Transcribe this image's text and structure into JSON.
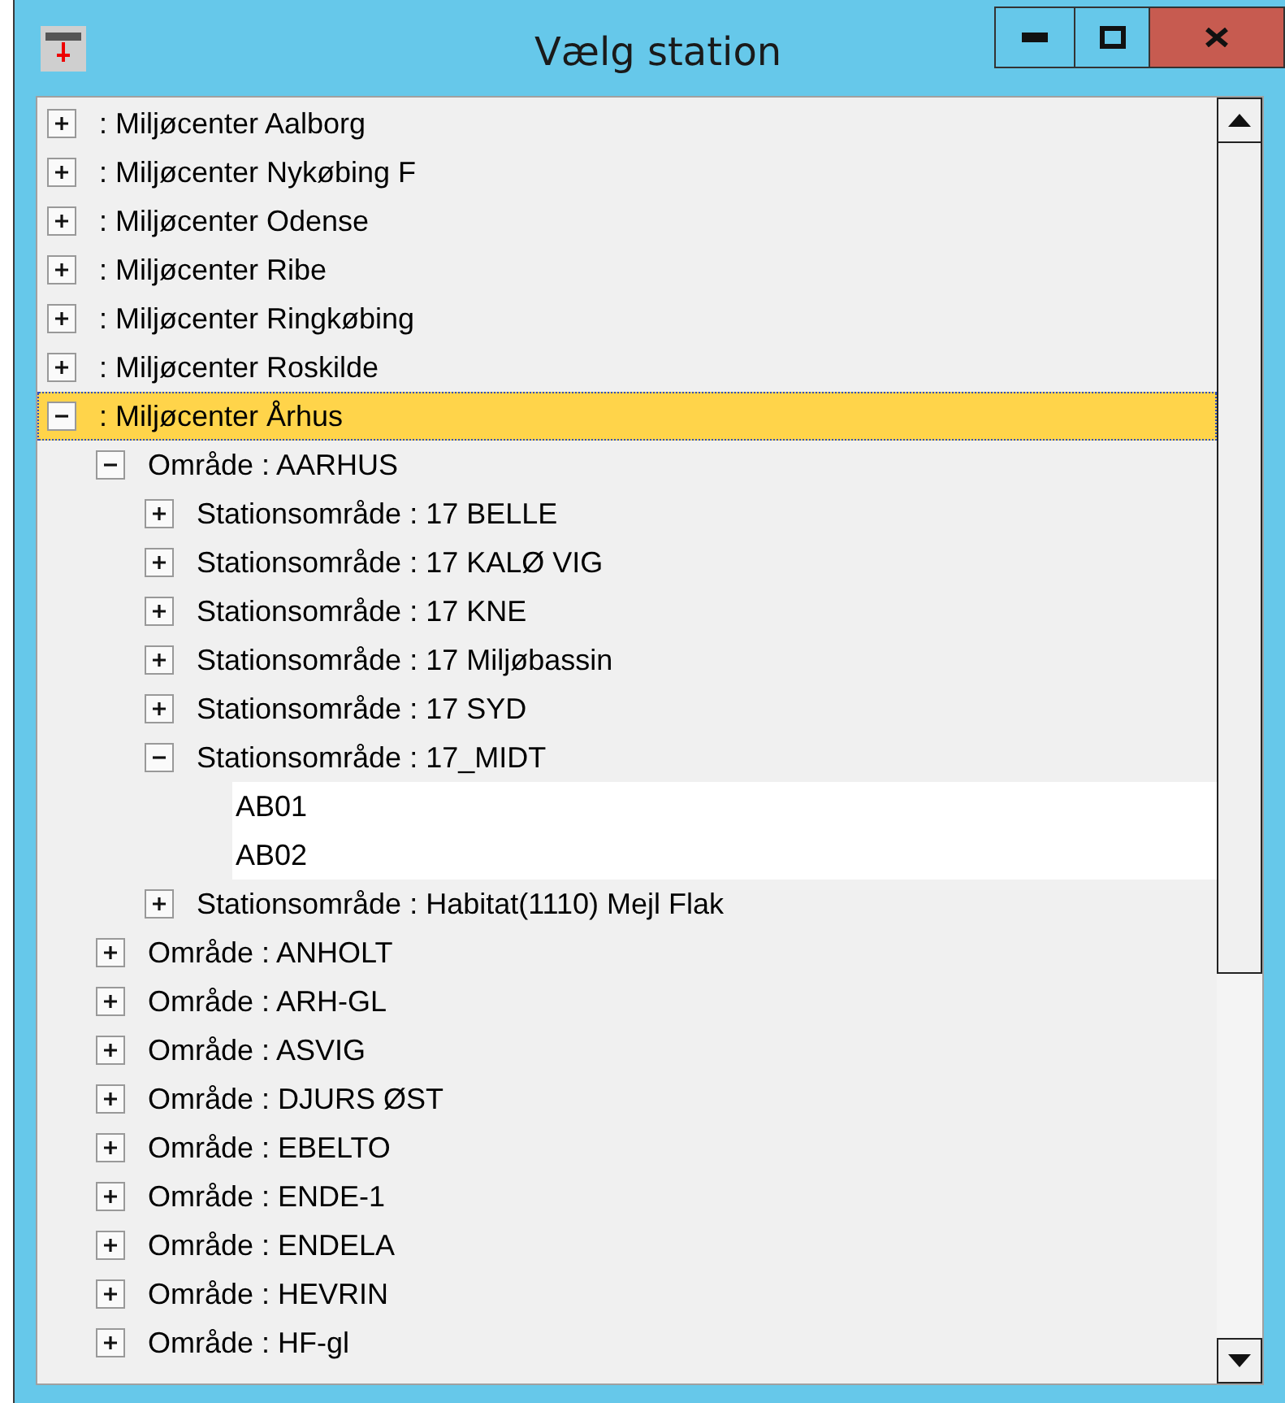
{
  "window": {
    "title": "Vælg station"
  },
  "tree": [
    {
      "kind": "group",
      "label": ": Miljøcenter Aalborg",
      "expanded": false,
      "selected": false
    },
    {
      "kind": "group",
      "label": ": Miljøcenter Nykøbing F",
      "expanded": false,
      "selected": false
    },
    {
      "kind": "group",
      "label": ": Miljøcenter Odense",
      "expanded": false,
      "selected": false
    },
    {
      "kind": "group",
      "label": ": Miljøcenter Ribe",
      "expanded": false,
      "selected": false
    },
    {
      "kind": "group",
      "label": ": Miljøcenter Ringkøbing",
      "expanded": false,
      "selected": false
    },
    {
      "kind": "group",
      "label": ": Miljøcenter Roskilde",
      "expanded": false,
      "selected": false
    },
    {
      "kind": "group",
      "label": ": Miljøcenter Århus",
      "expanded": true,
      "selected": true,
      "children": [
        {
          "kind": "group",
          "label": "Område : AARHUS",
          "expanded": true,
          "selected": false,
          "children": [
            {
              "kind": "group",
              "label": "Stationsområde : 17 BELLE",
              "expanded": false,
              "selected": false
            },
            {
              "kind": "group",
              "label": "Stationsområde : 17 KALØ VIG",
              "expanded": false,
              "selected": false
            },
            {
              "kind": "group",
              "label": "Stationsområde : 17 KNE",
              "expanded": false,
              "selected": false
            },
            {
              "kind": "group",
              "label": "Stationsområde : 17 Miljøbassin",
              "expanded": false,
              "selected": false
            },
            {
              "kind": "group",
              "label": "Stationsområde : 17 SYD",
              "expanded": false,
              "selected": false
            },
            {
              "kind": "group",
              "label": "Stationsområde : 17_MIDT",
              "expanded": true,
              "selected": false,
              "children": [
                {
                  "kind": "station",
                  "label": "AB01",
                  "selected": false
                },
                {
                  "kind": "station",
                  "label": "AB02",
                  "selected": false
                }
              ]
            },
            {
              "kind": "group",
              "label": "Stationsområde : Habitat(1110) Mejl Flak",
              "expanded": false,
              "selected": false
            }
          ]
        },
        {
          "kind": "group",
          "label": "Område : ANHOLT",
          "expanded": false,
          "selected": false
        },
        {
          "kind": "group",
          "label": "Område : ARH-GL",
          "expanded": false,
          "selected": false
        },
        {
          "kind": "group",
          "label": "Område : ASVIG",
          "expanded": false,
          "selected": false
        },
        {
          "kind": "group",
          "label": "Område : DJURS ØST",
          "expanded": false,
          "selected": false
        },
        {
          "kind": "group",
          "label": "Område : EBELTO",
          "expanded": false,
          "selected": false
        },
        {
          "kind": "group",
          "label": "Område : ENDE-1",
          "expanded": false,
          "selected": false
        },
        {
          "kind": "group",
          "label": "Område : ENDELA",
          "expanded": false,
          "selected": false
        },
        {
          "kind": "group",
          "label": "Område : HEVRIN",
          "expanded": false,
          "selected": false
        },
        {
          "kind": "group",
          "label": "Område : HF-gl",
          "expanded": false,
          "selected": false
        }
      ]
    }
  ]
}
